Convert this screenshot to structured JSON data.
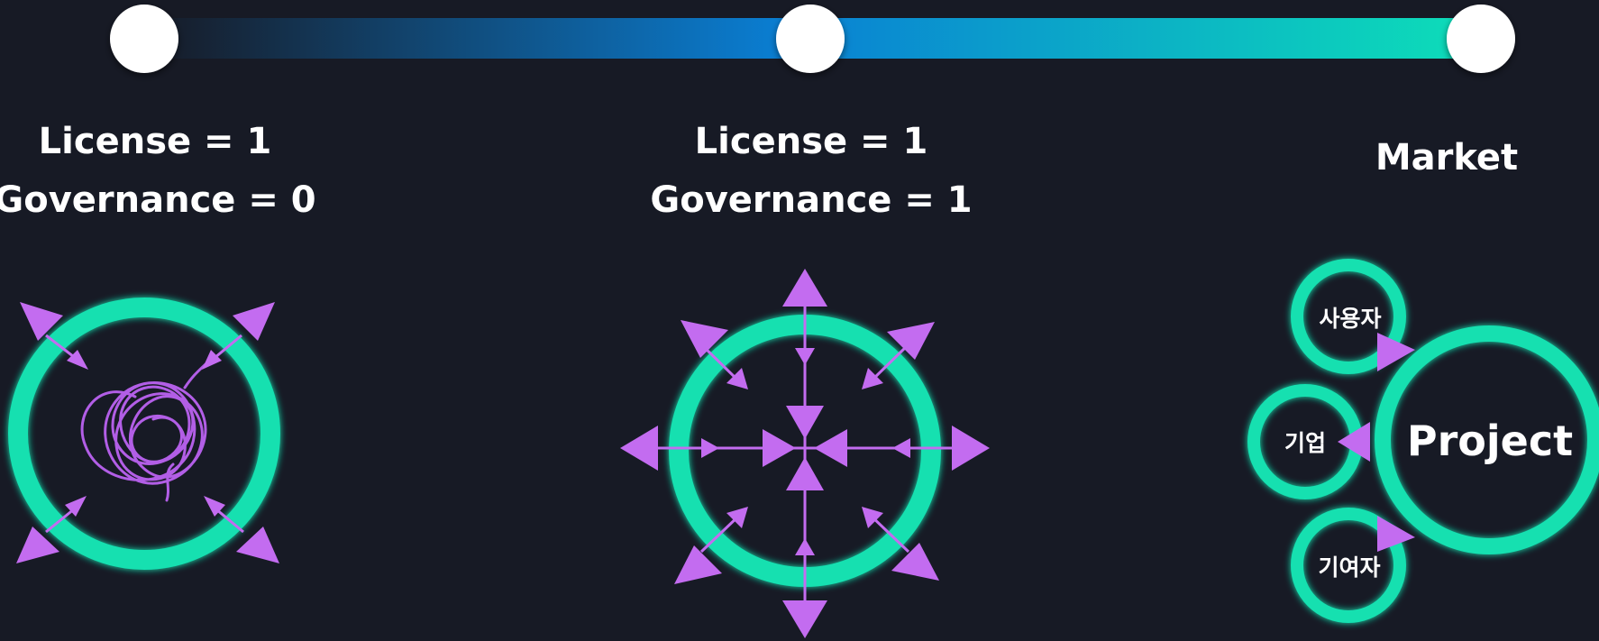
{
  "colors": {
    "background": "#171a25",
    "ring": "#12e0b0",
    "arrow": "#c36cf0",
    "tangle": "#b25ee6",
    "timeline_start": "#171a25",
    "timeline_mid": "#0a7fd4",
    "timeline_end": "#0ddfb8",
    "node": "#ffffff"
  },
  "stages": [
    {
      "line1": "License = 1",
      "line2": "Governance = 0"
    },
    {
      "line1": "License = 1",
      "line2": "Governance = 1"
    },
    {
      "line1": "Market"
    }
  ],
  "market": {
    "center": "Project",
    "users": "사용자",
    "company": "기업",
    "contributor": "기여자"
  }
}
